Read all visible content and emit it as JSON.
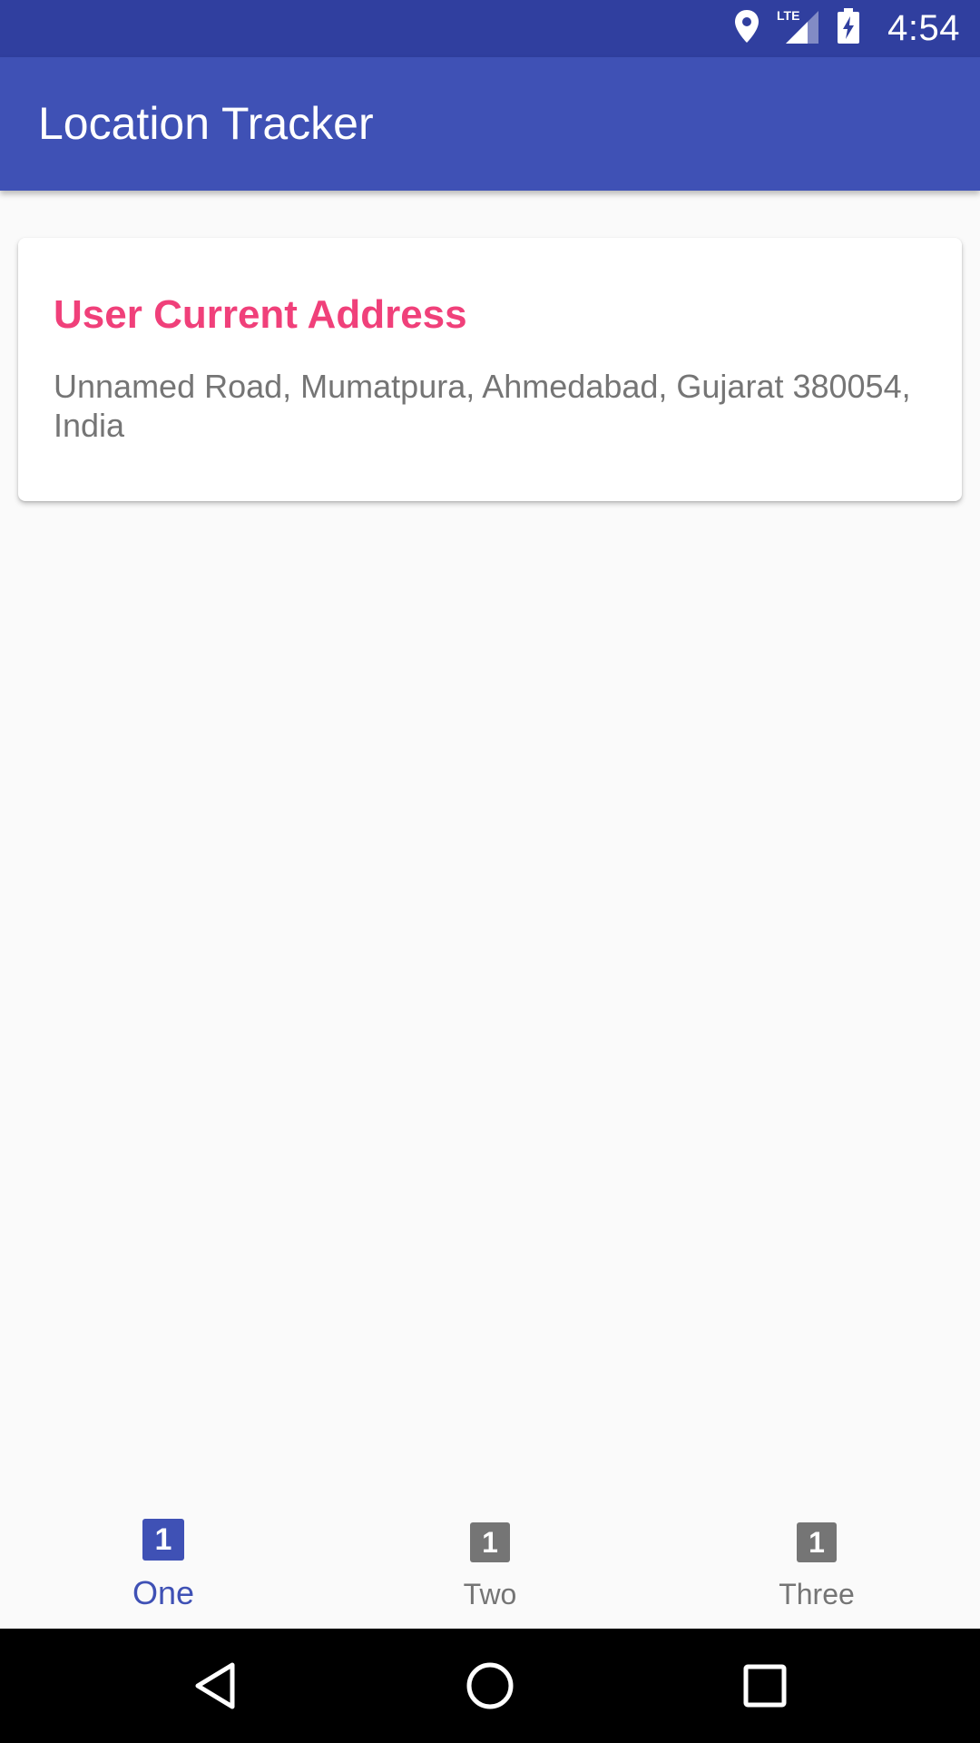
{
  "status_bar": {
    "time": "4:54",
    "network_label": "LTE",
    "icons": [
      "location-icon",
      "lte-signal-icon",
      "battery-charging-icon"
    ]
  },
  "app_bar": {
    "title": "Location Tracker"
  },
  "card": {
    "title": "User Current Address",
    "address": "Unnamed Road, Mumatpura, Ahmedabad, Gujarat 380054, India"
  },
  "bottom_nav": {
    "items": [
      {
        "label": "One",
        "badge": "1",
        "active": true
      },
      {
        "label": "Two",
        "badge": "1",
        "active": false
      },
      {
        "label": "Three",
        "badge": "1",
        "active": false
      }
    ]
  },
  "system_nav": {
    "buttons": [
      "back-icon",
      "home-icon",
      "recents-icon"
    ]
  },
  "colors": {
    "status_bar": "#303f9f",
    "primary": "#3f51b5",
    "accent": "#f0407a",
    "background": "#fafafa",
    "secondary_text": "#757575"
  }
}
